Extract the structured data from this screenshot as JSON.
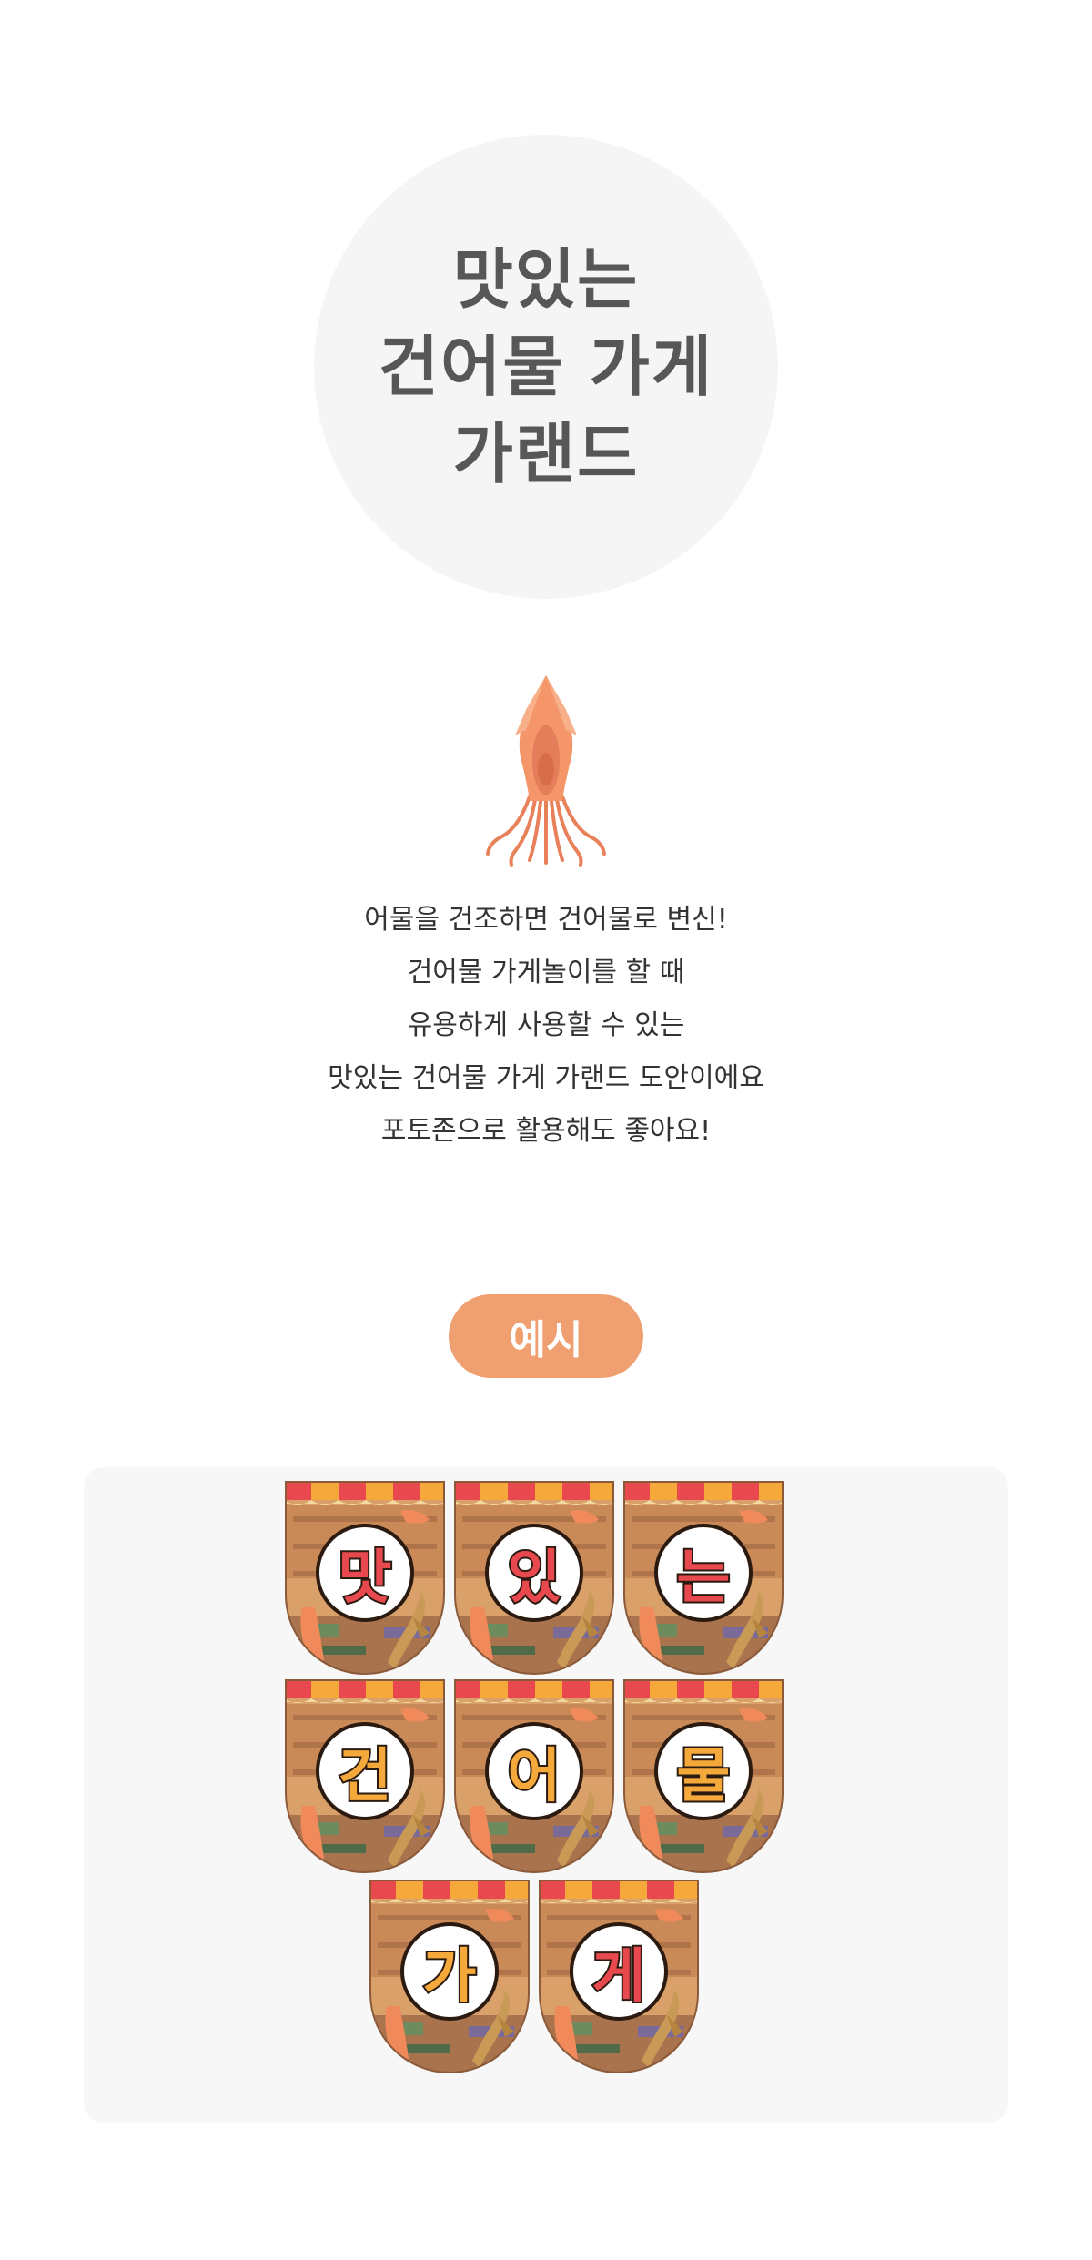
{
  "title": {
    "lines": [
      "맛있는",
      "건어물 가게",
      "가랜드"
    ]
  },
  "icons": {
    "hero": "squid-icon"
  },
  "description": {
    "lines": [
      "어물을 건조하면 건어물로 변신!",
      "건어물 가게놀이를 할 때",
      "유용하게 사용할 수 있는",
      "맛있는 건어물 가게 가랜드 도안이에요",
      "포토존으로 활용해도 좋아요!"
    ]
  },
  "example": {
    "label": "예시",
    "flags": [
      {
        "char": "맛",
        "color": "#e8494f"
      },
      {
        "char": "있",
        "color": "#e8494f"
      },
      {
        "char": "는",
        "color": "#e8494f"
      },
      {
        "char": "건",
        "color": "#f6a93b"
      },
      {
        "char": "어",
        "color": "#f6a93b"
      },
      {
        "char": "물",
        "color": "#f6a93b"
      },
      {
        "char": "가",
        "color": "#f6a93b"
      },
      {
        "char": "게",
        "color": "#e8494f"
      }
    ]
  },
  "colors": {
    "accent": "#f0a070",
    "title": "#575757",
    "circle_bg": "#f5f5f5",
    "panel_bg": "#f7f7f7",
    "squid": "#f4966a"
  }
}
